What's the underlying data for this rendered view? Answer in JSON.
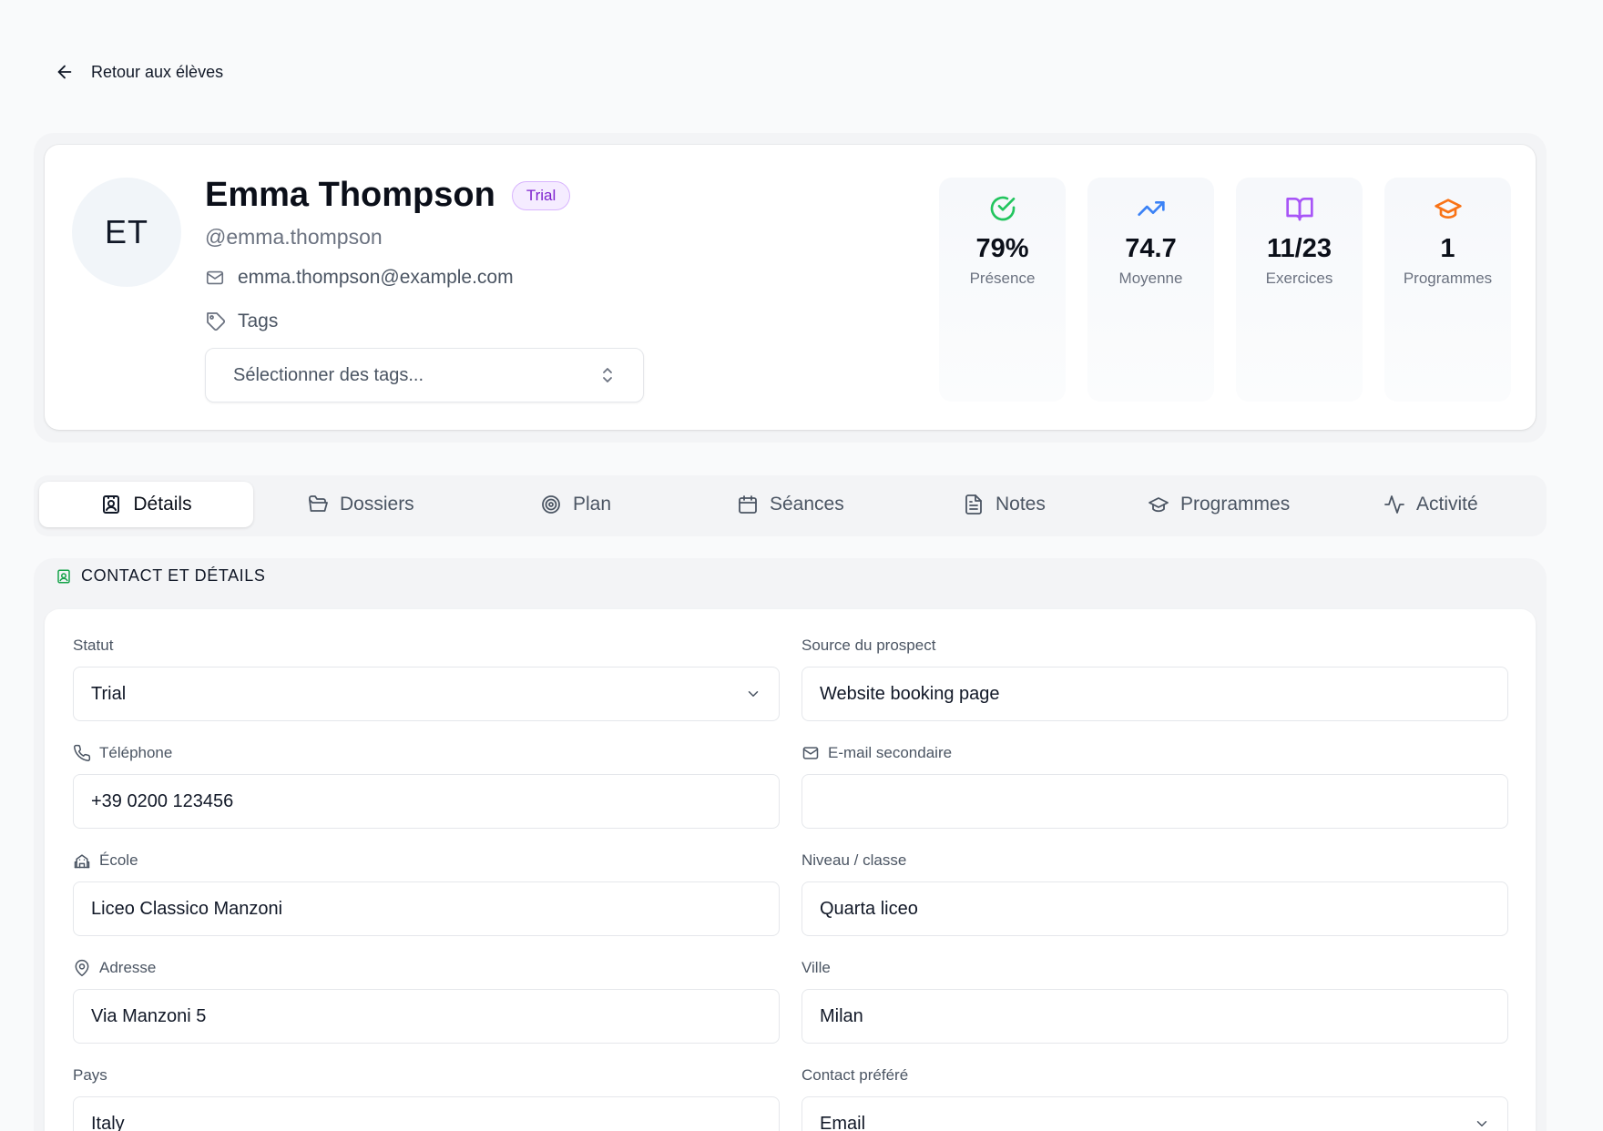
{
  "back": {
    "label": "Retour aux élèves"
  },
  "profile": {
    "initials": "ET",
    "name": "Emma Thompson",
    "badge": "Trial",
    "handle": "@emma.thompson",
    "email": "emma.thompson@example.com",
    "tags_label": "Tags",
    "tags_placeholder": "Sélectionner des tags..."
  },
  "stats": [
    {
      "value": "79%",
      "label": "Présence",
      "icon": "check-circle-icon",
      "color": "#22c55e"
    },
    {
      "value": "74.7",
      "label": "Moyenne",
      "icon": "trending-up-icon",
      "color": "#3b82f6"
    },
    {
      "value": "11/23",
      "label": "Exercices",
      "icon": "book-open-icon",
      "color": "#a855f7"
    },
    {
      "value": "1",
      "label": "Programmes",
      "icon": "graduation-cap-icon",
      "color": "#f97316"
    }
  ],
  "tabs": [
    {
      "label": "Détails",
      "icon": "contact-card-icon",
      "active": true
    },
    {
      "label": "Dossiers",
      "icon": "folder-open-icon"
    },
    {
      "label": "Plan",
      "icon": "target-icon"
    },
    {
      "label": "Séances",
      "icon": "calendar-icon"
    },
    {
      "label": "Notes",
      "icon": "file-text-icon"
    },
    {
      "label": "Programmes",
      "icon": "graduation-cap-icon"
    },
    {
      "label": "Activité",
      "icon": "activity-icon"
    }
  ],
  "section": {
    "title": "CONTACT ET DÉTAILS",
    "accent": "#16a34a"
  },
  "fields": {
    "statut": {
      "label": "Statut",
      "value": "Trial"
    },
    "source": {
      "label": "Source du prospect",
      "value": "Website booking page"
    },
    "telephone": {
      "label": "Téléphone",
      "value": "+39 0200 123456"
    },
    "email2": {
      "label": "E-mail secondaire",
      "value": ""
    },
    "ecole": {
      "label": "École",
      "value": "Liceo Classico Manzoni"
    },
    "niveau": {
      "label": "Niveau / classe",
      "value": "Quarta liceo"
    },
    "adresse": {
      "label": "Adresse",
      "value": "Via Manzoni 5"
    },
    "ville": {
      "label": "Ville",
      "value": "Milan"
    },
    "pays": {
      "label": "Pays",
      "value": "Italy"
    },
    "contact": {
      "label": "Contact préféré",
      "value": "Email"
    }
  }
}
